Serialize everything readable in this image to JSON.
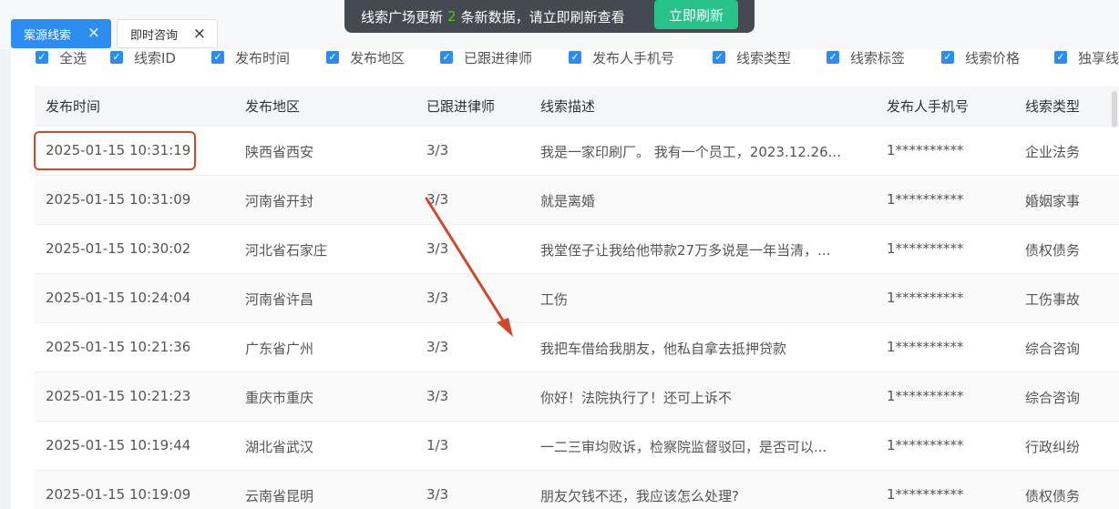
{
  "tabs": [
    {
      "label": "案源线索",
      "active": true
    },
    {
      "label": "即时咨询",
      "active": false
    }
  ],
  "notice": {
    "prefix": "线索广场更新",
    "count": "2",
    "suffix": "条新数据，请立即刷新查看",
    "button": "立即刷新"
  },
  "columns_filter": [
    "全选",
    "线索ID",
    "发布时间",
    "发布地区",
    "已跟进律师",
    "发布人手机号",
    "线索类型",
    "线索标签",
    "线索价格",
    "独享线"
  ],
  "table": {
    "headers": [
      "发布时间",
      "发布地区",
      "已跟进律师",
      "线索描述",
      "发布人手机号",
      "线索类型"
    ],
    "rows": [
      {
        "time": "2025-01-15 10:31:19",
        "region": "陕西省西安",
        "lawyers": "3/3",
        "desc": "我是一家印刷厂。 我有一个员工，2023.12.26...",
        "phone": "1**********",
        "type": "企业法务"
      },
      {
        "time": "2025-01-15 10:31:09",
        "region": "河南省开封",
        "lawyers": "3/3",
        "desc": "就是离婚",
        "phone": "1**********",
        "type": "婚姻家事"
      },
      {
        "time": "2025-01-15 10:30:02",
        "region": "河北省石家庄",
        "lawyers": "3/3",
        "desc": "我堂侄子让我给他带款27万多说是一年当清，...",
        "phone": "1**********",
        "type": "债权债务"
      },
      {
        "time": "2025-01-15 10:24:04",
        "region": "河南省许昌",
        "lawyers": "3/3",
        "desc": "工伤",
        "phone": "1**********",
        "type": "工伤事故"
      },
      {
        "time": "2025-01-15 10:21:36",
        "region": "广东省广州",
        "lawyers": "3/3",
        "desc": "我把车借给我朋友，他私自拿去抵押贷款",
        "phone": "1**********",
        "type": "综合咨询"
      },
      {
        "time": "2025-01-15 10:21:23",
        "region": "重庆市重庆",
        "lawyers": "3/3",
        "desc": "你好！法院执行了！还可上诉不",
        "phone": "1**********",
        "type": "综合咨询"
      },
      {
        "time": "2025-01-15 10:19:44",
        "region": "湖北省武汉",
        "lawyers": "1/3",
        "desc": "一二三审均败诉，检察院监督驳回，是否可以...",
        "phone": "1**********",
        "type": "行政纠纷"
      },
      {
        "time": "2025-01-15 10:19:09",
        "region": "云南省昆明",
        "lawyers": "3/3",
        "desc": "朋友欠钱不还，我应该怎么处理?",
        "phone": "1**********",
        "type": "债权债务"
      }
    ]
  },
  "colors": {
    "primary": "#2d8cf0",
    "refresh": "#27c38a",
    "annotation": "#d0482a"
  },
  "icons": {
    "tab_close": "close-icon",
    "checkbox": "checkbox-checked-icon"
  }
}
